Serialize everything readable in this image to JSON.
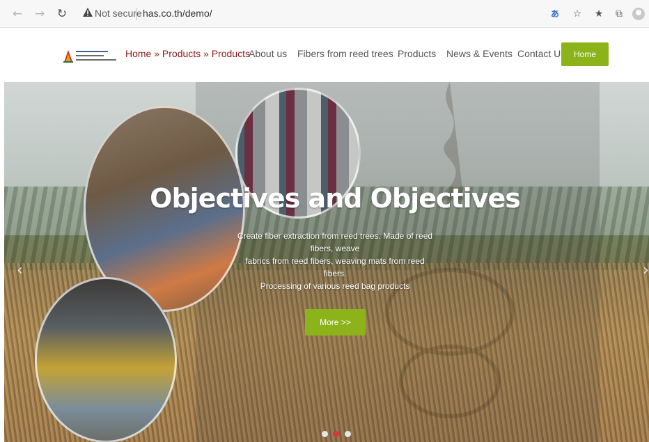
{
  "browser": {
    "security_label": "Not secure",
    "url": "has.co.th/demo/",
    "icons": [
      "back-icon",
      "forward-icon",
      "reload-icon",
      "warning-icon",
      "translate-icon",
      "read-aloud-icon",
      "favorites-icon",
      "collections-icon",
      "profile-icon"
    ]
  },
  "header": {
    "logo_alt": "logo",
    "breadcrumb": "Home » Products » Products",
    "nav": [
      "About us",
      "Fibers from reed trees",
      "Products",
      "News & Events",
      "Contact Us"
    ],
    "home_button": "Home"
  },
  "hero": {
    "title": "Objectives and Objectives",
    "description_lines": [
      "Create fiber extraction from reed trees. Made of reed",
      "fibers, weave",
      "fabrics from reed fibers, weaving mats from reed fibers.",
      "Processing of various reed bag products"
    ],
    "more_button": "More >>",
    "prev_arrow": "‹",
    "next_arrow": "›",
    "slides": 3,
    "active_slide": 2
  },
  "colors": {
    "accent_green": "#8db31b",
    "breadcrumb_red": "#8b1a1a",
    "active_dot": "#d8363d"
  }
}
